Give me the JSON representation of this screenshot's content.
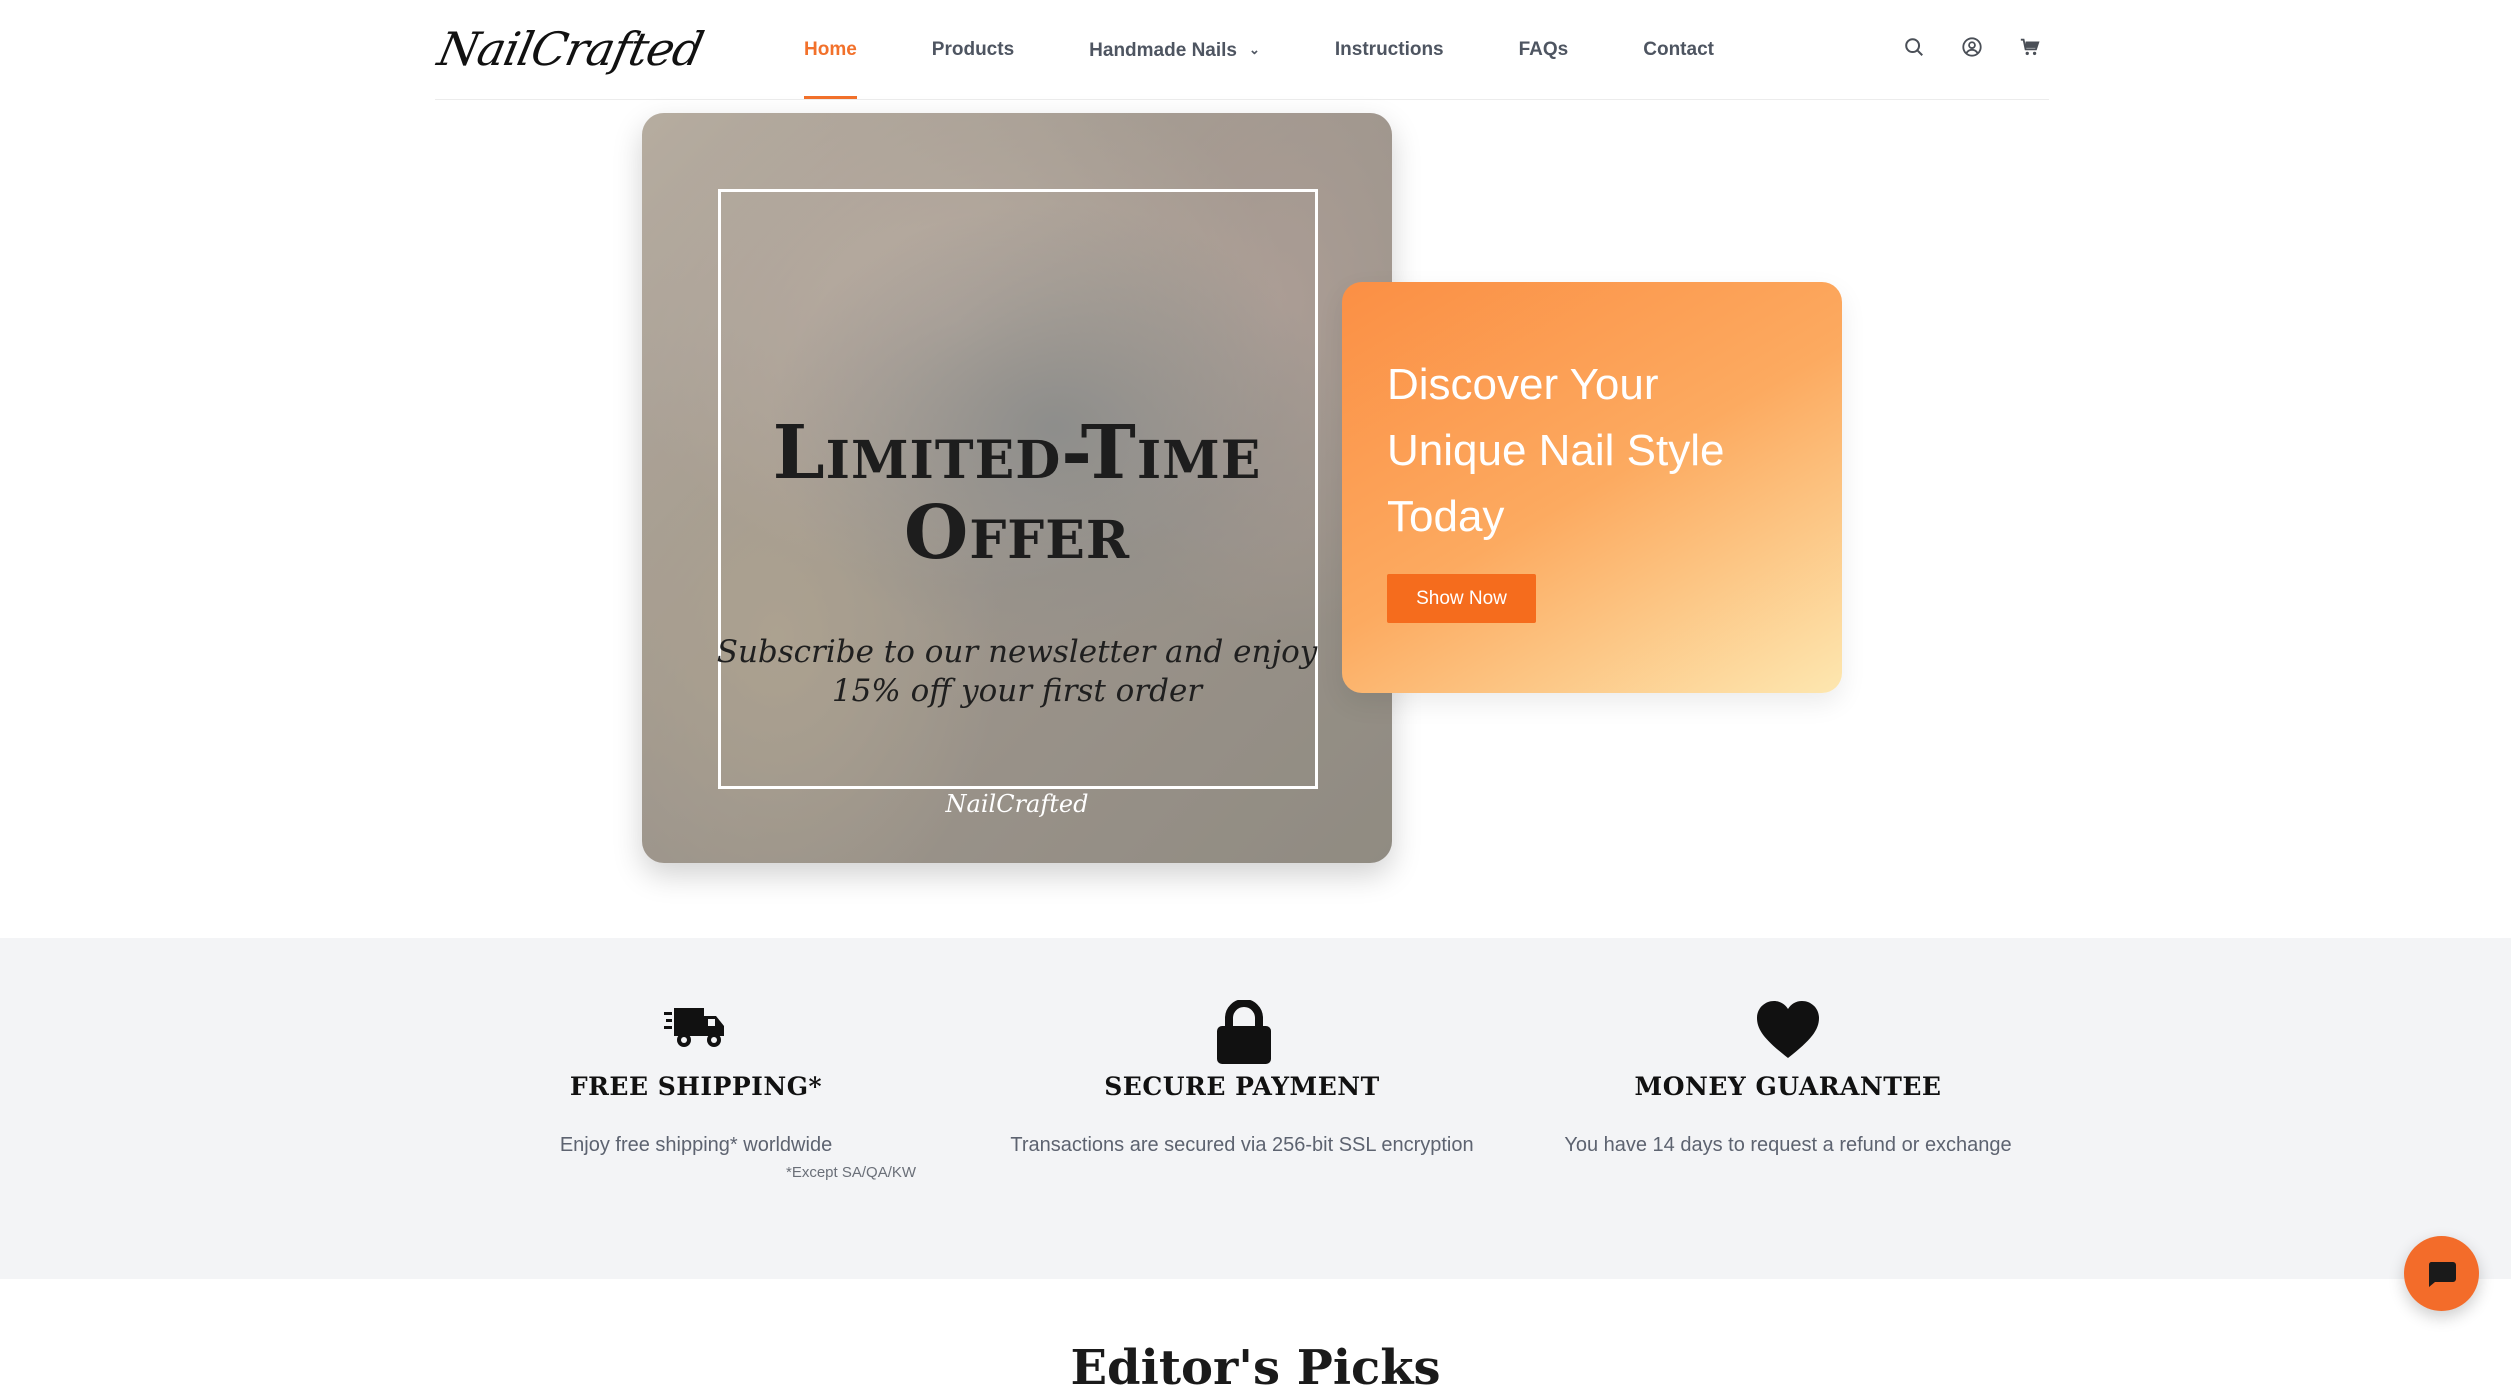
{
  "brand": {
    "logo_text": "NailCrafted"
  },
  "nav": {
    "items": [
      {
        "label": "Home",
        "active": true
      },
      {
        "label": "Products",
        "active": false
      },
      {
        "label": "Handmade Nails",
        "active": false,
        "has_dropdown": true
      },
      {
        "label": "Instructions",
        "active": false
      },
      {
        "label": "FAQs",
        "active": false
      },
      {
        "label": "Contact",
        "active": false
      }
    ],
    "icons": [
      "search-icon",
      "account-icon",
      "cart-icon"
    ]
  },
  "hero": {
    "offer_title_line1": "Limited-Time",
    "offer_title_line2": "Offer",
    "offer_sub_line1": "Subscribe to our newsletter and enjoy",
    "offer_sub_line2": "15% off your first order",
    "watermark": "NailCrafted"
  },
  "promo": {
    "title_line1": "Discover Your",
    "title_line2": "Unique Nail Style",
    "title_line3": "Today",
    "button_label": "Show Now"
  },
  "features": [
    {
      "icon": "truck-icon",
      "title": "FREE SHIPPING*",
      "desc": "Enjoy free shipping* worldwide",
      "note": "*Except SA/QA/KW"
    },
    {
      "icon": "lock-icon",
      "title": "SECURE PAYMENT",
      "desc": "Transactions are secured via 256-bit SSL encryption"
    },
    {
      "icon": "heart-icon",
      "title": "MONEY GUARANTEE",
      "desc": "You have 14 days to request a refund or exchange"
    }
  ],
  "section": {
    "title": "Editor's Picks"
  },
  "colors": {
    "accent": "#f2712b",
    "button": "#f56c1d",
    "features_bg": "#f3f4f6"
  }
}
